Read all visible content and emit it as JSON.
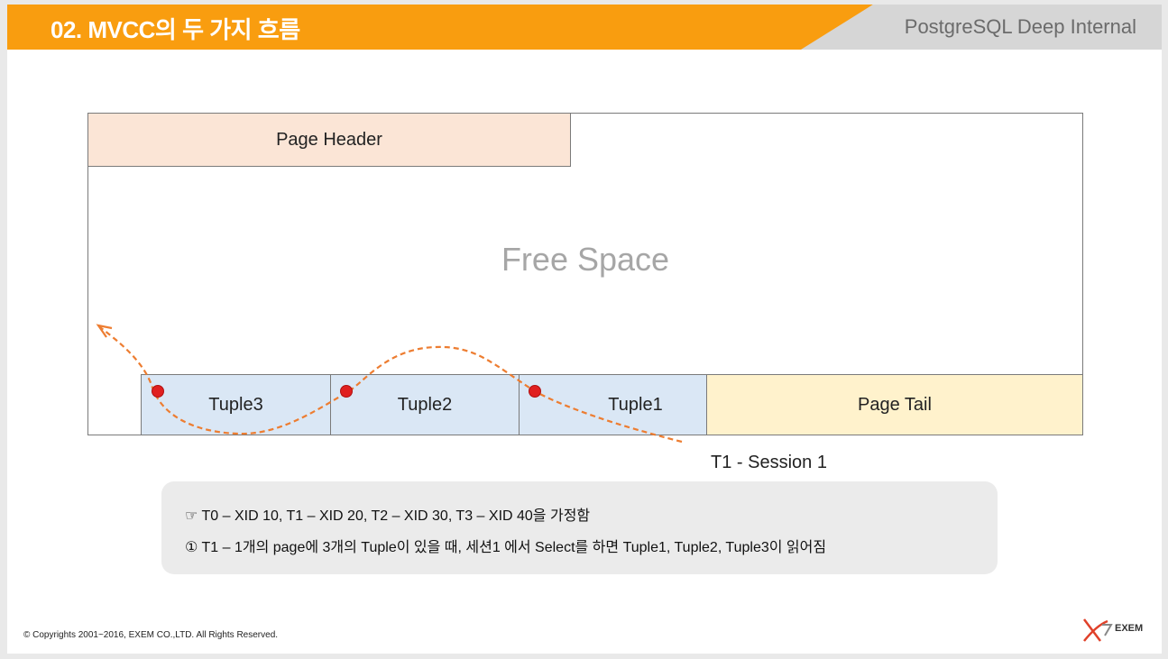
{
  "header": {
    "title": "02. MVCC의 두 가지 흐름",
    "brand": "PostgreSQL Deep Internal"
  },
  "diagram": {
    "page_header": "Page Header",
    "free_space": "Free Space",
    "tuples": [
      "Tuple3",
      "Tuple2",
      "Tuple1"
    ],
    "page_tail": "Page Tail",
    "session_label": "T1 - Session 1"
  },
  "notes": {
    "line1": "☞ T0 – XID 10, T1 – XID 20, T2 – XID 30, T3 – XID 40을 가정함",
    "line2": "① T1 – 1개의 page에 3개의 Tuple이 있을 때, 세션1 에서 Select를 하면 Tuple1, Tuple2, Tuple3이 읽어짐"
  },
  "footer": {
    "copyright": "© Copyrights 2001~2016, EXEM CO.,LTD. All Rights Reserved.",
    "logo_text": "EXEM"
  },
  "colors": {
    "title_bar": "#f99d0f",
    "brand_bar": "#d6d6d6",
    "page_header_fill": "#fbe5d6",
    "tuple_fill": "#dae7f5",
    "page_tail_fill": "#fff2cc",
    "flow_arrow": "#ed7d31",
    "read_marker": "#e02020",
    "note_box": "#ebebeb"
  }
}
